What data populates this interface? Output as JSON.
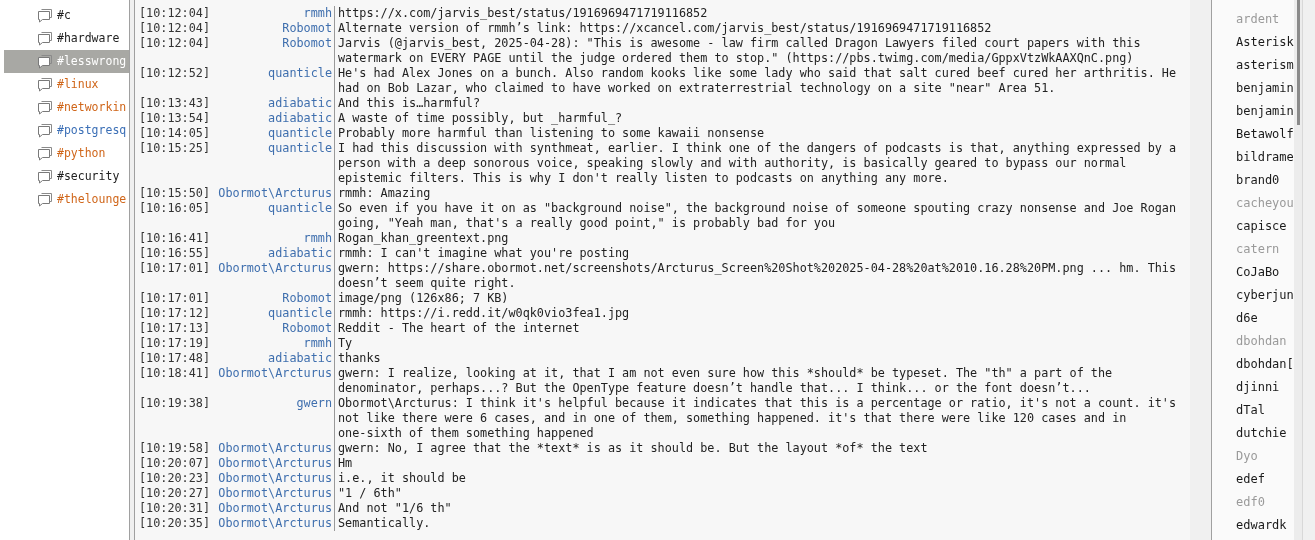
{
  "channels": [
    {
      "name": "#c",
      "selected": false,
      "color": "#222222"
    },
    {
      "name": "#hardware",
      "selected": false,
      "color": "#222222"
    },
    {
      "name": "#lesswrong",
      "selected": true,
      "color": "#ffffff"
    },
    {
      "name": "#linux",
      "selected": false,
      "color": "#d0661a"
    },
    {
      "name": "#networkin",
      "selected": false,
      "color": "#d0661a"
    },
    {
      "name": "#postgresq",
      "selected": false,
      "color": "#3b6fb6"
    },
    {
      "name": "#python",
      "selected": false,
      "color": "#d0661a"
    },
    {
      "name": "#security",
      "selected": false,
      "color": "#222222"
    },
    {
      "name": "#thelounge",
      "selected": false,
      "color": "#d0661a"
    }
  ],
  "messages": [
    {
      "time": "[10:12:04]",
      "nick": "rmmh",
      "lines": [
        "https://x.com/jarvis_best/status/1916969471719116852"
      ]
    },
    {
      "time": "[10:12:04]",
      "nick": "Robomot",
      "lines": [
        "Alternate version of rmmh’s link: https://xcancel.com/jarvis_best/status/1916969471719116852"
      ]
    },
    {
      "time": "[10:12:04]",
      "nick": "Robomot",
      "lines": [
        "Jarvis (@jarvis_best, 2025-04-28): \"This is awesome - law firm called Dragon Lawyers filed court papers with this",
        "watermark on EVERY PAGE until the judge ordered them to stop.\" (https://pbs.twimg.com/media/GppxVtzWkAAXQnC.png)"
      ]
    },
    {
      "time": "[10:12:52]",
      "nick": "quanticle",
      "lines": [
        "He's had Alex Jones on a bunch. Also random kooks like some lady who said that salt cured beef cured her arthritis. He",
        "had on Bob Lazar, who claimed to have worked on extraterrestrial technology on a site \"near\" Area 51."
      ]
    },
    {
      "time": "[10:13:43]",
      "nick": "adiabatic",
      "lines": [
        "And this is…harmful?"
      ]
    },
    {
      "time": "[10:13:54]",
      "nick": "adiabatic",
      "lines": [
        "A waste of time possibly, but _harmful_?"
      ]
    },
    {
      "time": "[10:14:05]",
      "nick": "quanticle",
      "lines": [
        "Probably more harmful than listening to some kawaii nonsense"
      ]
    },
    {
      "time": "[10:15:25]",
      "nick": "quanticle",
      "lines": [
        "I had this discussion with synthmeat, earlier. I think one of the dangers of podcasts is that, anything expressed by a",
        "person with a deep sonorous voice, speaking slowly and with authority, is basically geared to bypass our normal",
        "epistemic filters. This is why I don't really listen to podcasts on anything any more."
      ]
    },
    {
      "time": "[10:15:50]",
      "nick": "Obormot\\Arcturus",
      "lines": [
        "rmmh: Amazing"
      ]
    },
    {
      "time": "[10:16:05]",
      "nick": "quanticle",
      "lines": [
        "So even if you have it on as \"background noise\", the background noise of someone spouting crazy nonsense and Joe Rogan",
        "going, \"Yeah man, that's a really good point,\" is probably bad for you"
      ]
    },
    {
      "time": "[10:16:41]",
      "nick": "rmmh",
      "lines": [
        "Rogan_khan_greentext.png"
      ]
    },
    {
      "time": "[10:16:55]",
      "nick": "adiabatic",
      "lines": [
        "rmmh: I can't imagine what you're posting"
      ]
    },
    {
      "time": "[10:17:01]",
      "nick": "Obormot\\Arcturus",
      "lines": [
        "gwern: https://share.obormot.net/screenshots/Arcturus_Screen%20Shot%202025-04-28%20at%2010.16.28%20PM.png ... hm. This",
        "doesn’t seem quite right."
      ]
    },
    {
      "time": "[10:17:01]",
      "nick": "Robomot",
      "lines": [
        "image/png (126x86; 7 KB)"
      ]
    },
    {
      "time": "[10:17:12]",
      "nick": "quanticle",
      "lines": [
        "rmmh: https://i.redd.it/w0qk0vio3fea1.jpg"
      ]
    },
    {
      "time": "[10:17:13]",
      "nick": "Robomot",
      "lines": [
        "Reddit - The heart of the internet"
      ]
    },
    {
      "time": "[10:17:19]",
      "nick": "rmmh",
      "lines": [
        "Ty"
      ]
    },
    {
      "time": "[10:17:48]",
      "nick": "adiabatic",
      "lines": [
        "thanks"
      ]
    },
    {
      "time": "[10:18:41]",
      "nick": "Obormot\\Arcturus",
      "lines": [
        "gwern: I realize, looking at it, that I am not even sure how this *should* be typeset. The \"th\" a part of the",
        "denominator, perhaps...? But the OpenType feature doesn’t handle that... I think... or the font doesn’t..."
      ]
    },
    {
      "time": "[10:19:38]",
      "nick": "gwern",
      "lines": [
        "Obormot\\Arcturus: I think it's helpful because it indicates that this is a percentage or ratio, it's not a count. it's",
        "not like there were 6 cases, and in one of them, something happened. it's that there were like 120 cases and in",
        "one-sixth of them something happened"
      ]
    },
    {
      "time": "[10:19:58]",
      "nick": "Obormot\\Arcturus",
      "lines": [
        "gwern: No, I agree that the *text* is as it should be. But the layout *of* the text"
      ]
    },
    {
      "time": "[10:20:07]",
      "nick": "Obormot\\Arcturus",
      "lines": [
        "Hm"
      ]
    },
    {
      "time": "[10:20:23]",
      "nick": "Obormot\\Arcturus",
      "lines": [
        "i.e., it should be"
      ]
    },
    {
      "time": "[10:20:27]",
      "nick": "Obormot\\Arcturus",
      "lines": [
        "\"1 / 6th\""
      ]
    },
    {
      "time": "[10:20:31]",
      "nick": "Obormot\\Arcturus",
      "lines": [
        "And not \"1/6 th\""
      ]
    },
    {
      "time": "[10:20:35]",
      "nick": "Obormot\\Arcturus",
      "lines": [
        "Semantically."
      ]
    }
  ],
  "users": [
    {
      "nick": "ardent",
      "away": true
    },
    {
      "nick": "Asterisk",
      "away": false
    },
    {
      "nick": "asterism",
      "away": false
    },
    {
      "nick": "benjamin",
      "away": false
    },
    {
      "nick": "benjamin",
      "away": false
    },
    {
      "nick": "Betawolf",
      "away": false
    },
    {
      "nick": "bildrame",
      "away": false
    },
    {
      "nick": "brand0",
      "away": false
    },
    {
      "nick": "cacheyou",
      "away": true
    },
    {
      "nick": "capisce",
      "away": false
    },
    {
      "nick": "catern",
      "away": true
    },
    {
      "nick": "CoJaBo",
      "away": false
    },
    {
      "nick": "cyberjun",
      "away": false
    },
    {
      "nick": "d6e",
      "away": false
    },
    {
      "nick": "dbohdan",
      "away": true
    },
    {
      "nick": "dbohdan[",
      "away": false
    },
    {
      "nick": "djinni",
      "away": false
    },
    {
      "nick": "dTal",
      "away": false
    },
    {
      "nick": "dutchie",
      "away": false
    },
    {
      "nick": "Dyo",
      "away": true
    },
    {
      "nick": "edef",
      "away": false
    },
    {
      "nick": "edf0",
      "away": true
    },
    {
      "nick": "edwardk",
      "away": false
    }
  ]
}
